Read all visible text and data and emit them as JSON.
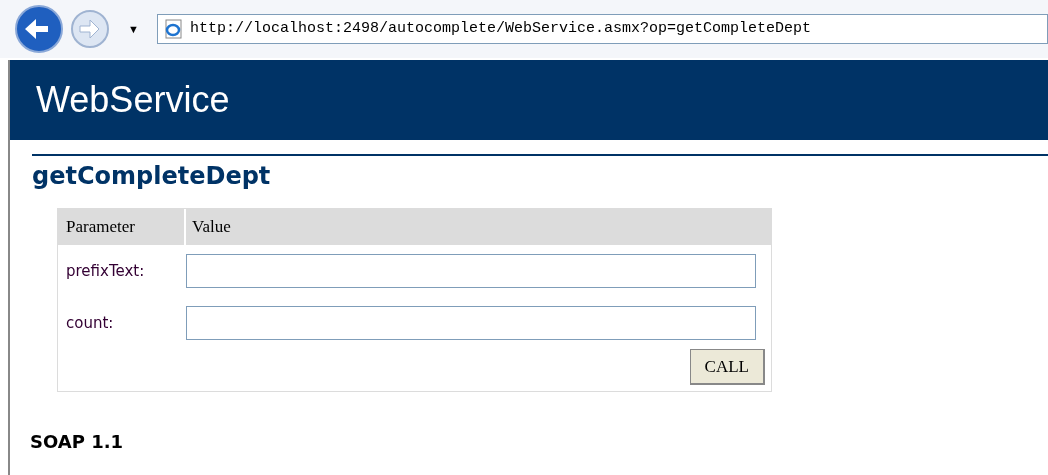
{
  "browser": {
    "dropdown_glyph": "▼",
    "address": "http://localhost:2498/autocomplete/WebService.asmx?op=getCompleteDept"
  },
  "header": {
    "title": "WebService"
  },
  "operation": {
    "title": "getCompleteDept"
  },
  "form": {
    "columns": [
      "Parameter",
      "Value"
    ],
    "rows": [
      {
        "label": "prefixText:",
        "value": ""
      },
      {
        "label": "count:",
        "value": ""
      }
    ],
    "button": "CALL"
  },
  "section": {
    "title": "SOAP 1.1"
  }
}
